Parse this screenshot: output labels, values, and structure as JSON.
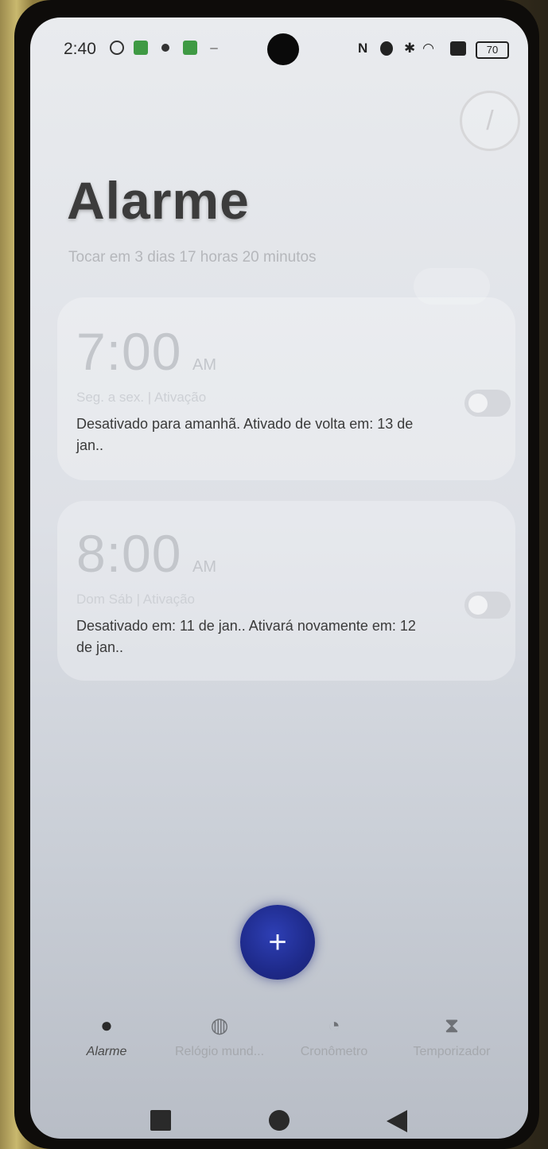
{
  "status_bar": {
    "time": "2:40",
    "battery": "70"
  },
  "header": {
    "title": "Alarme",
    "subtitle": "Tocar em 3 dias 17 horas 20 minutos",
    "edit_icon": "pencil-icon"
  },
  "alarms": [
    {
      "time": "7:00",
      "ampm": "AM",
      "days": "Seg. a sex. | Ativação",
      "note": "Desativado para amanhã. Ativado de volta em: 13 de jan..",
      "enabled": false
    },
    {
      "time": "8:00",
      "ampm": "AM",
      "days": "Dom Sáb | Ativação",
      "note": "Desativado em: 11 de jan.. Ativará novamente em: 12 de jan..",
      "enabled": false
    }
  ],
  "fab": {
    "icon": "plus-icon",
    "label": "+"
  },
  "bottom_nav": [
    {
      "label": "Alarme",
      "icon": "alarm-clock-icon",
      "active": true
    },
    {
      "label": "Relógio mund...",
      "icon": "globe-icon",
      "active": false
    },
    {
      "label": "Cronômetro",
      "icon": "stopwatch-icon",
      "active": false
    },
    {
      "label": "Temporizador",
      "icon": "hourglass-icon",
      "active": false
    }
  ],
  "colors": {
    "fab": "#1e2a8a",
    "screen_bg": "#e4e6ea"
  }
}
